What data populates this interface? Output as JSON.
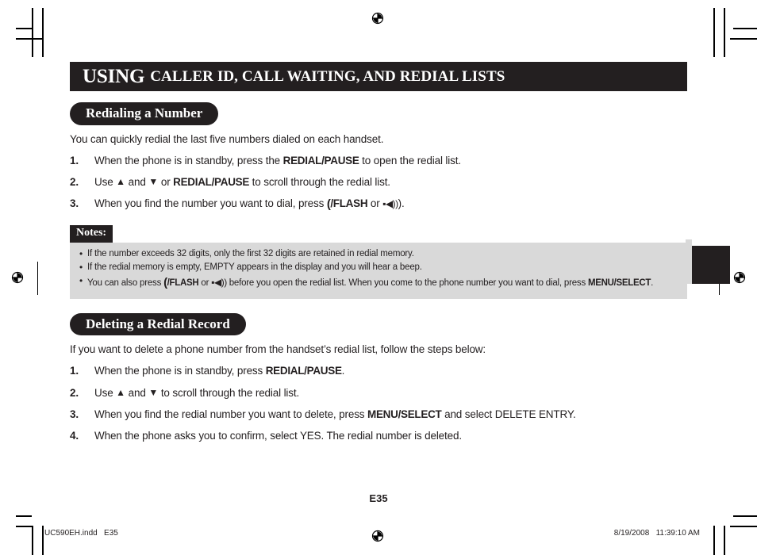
{
  "document": {
    "page_number": "E35",
    "footer_left": "UC590EH.indd   E35",
    "footer_right": "8/19/2008   11:39:10 AM",
    "colors": {
      "ink": "#231f20",
      "notes_background": "#d9d9d9",
      "paper": "#ffffff"
    }
  },
  "header": {
    "title_main": "USING",
    "title_rest": "CALLER ID, CALL WAITING, AND REDIAL LISTS"
  },
  "sections": [
    {
      "heading": "Redialing a Number",
      "intro": "You can quickly redial the last five numbers dialed on each handset.",
      "steps": [
        {
          "num": "1.",
          "parts": [
            {
              "t": "text",
              "v": "When the phone is in standby, press the "
            },
            {
              "t": "bold",
              "v": "REDIAL/PAUSE"
            },
            {
              "t": "text",
              "v": " to open the redial list."
            }
          ]
        },
        {
          "num": "2.",
          "parts": [
            {
              "t": "text",
              "v": "Use "
            },
            {
              "t": "icon",
              "v": "▲",
              "name": "arrow-up-icon"
            },
            {
              "t": "text",
              "v": " and "
            },
            {
              "t": "icon",
              "v": "▼",
              "name": "arrow-down-icon"
            },
            {
              "t": "text",
              "v": " or "
            },
            {
              "t": "bold",
              "v": "REDIAL/PAUSE"
            },
            {
              "t": "text",
              "v": " to scroll through the redial list."
            }
          ]
        },
        {
          "num": "3.",
          "parts": [
            {
              "t": "text",
              "v": "When you find the number you want to dial, press "
            },
            {
              "t": "talk",
              "v": "(",
              "name": "talk-handset-icon"
            },
            {
              "t": "bold",
              "v": "/FLASH"
            },
            {
              "t": "text",
              "v": " or "
            },
            {
              "t": "spk",
              "v": "▪◀))",
              "name": "speakerphone-icon"
            },
            {
              "t": "text",
              "v": ")."
            }
          ]
        }
      ]
    },
    {
      "heading": "Deleting a Redial Record",
      "intro": "If you want to delete a phone number from the handset’s redial list, follow the steps below:",
      "steps": [
        {
          "num": "1.",
          "parts": [
            {
              "t": "text",
              "v": "When the phone is in standby, press "
            },
            {
              "t": "bold",
              "v": "REDIAL/PAUSE"
            },
            {
              "t": "text",
              "v": "."
            }
          ]
        },
        {
          "num": "2.",
          "parts": [
            {
              "t": "text",
              "v": "Use "
            },
            {
              "t": "icon",
              "v": "▲",
              "name": "arrow-up-icon"
            },
            {
              "t": "text",
              "v": " and "
            },
            {
              "t": "icon",
              "v": "▼",
              "name": "arrow-down-icon"
            },
            {
              "t": "text",
              "v": " to scroll through the redial list."
            }
          ]
        },
        {
          "num": "3.",
          "parts": [
            {
              "t": "text",
              "v": "When you find the redial number you want to delete, press "
            },
            {
              "t": "bold",
              "v": "MENU/SELECT"
            },
            {
              "t": "text",
              "v": " and select DELETE ENTRY."
            }
          ]
        },
        {
          "num": "4.",
          "parts": [
            {
              "t": "text",
              "v": "When the phone asks you to confirm, select YES. The redial number is deleted."
            }
          ]
        }
      ]
    }
  ],
  "notes": {
    "label": "Notes:",
    "items": [
      {
        "parts": [
          {
            "t": "text",
            "v": "If the number exceeds 32 digits, only the first 32 digits are retained in redial memory."
          }
        ]
      },
      {
        "parts": [
          {
            "t": "text",
            "v": "If the redial memory is empty, EMPTY appears in the display and you will hear a beep."
          }
        ]
      },
      {
        "parts": [
          {
            "t": "text",
            "v": "You can also press "
          },
          {
            "t": "talk",
            "v": "(",
            "name": "talk-handset-icon"
          },
          {
            "t": "bold",
            "v": "/FLASH"
          },
          {
            "t": "text",
            "v": " or "
          },
          {
            "t": "spk",
            "v": "▪◀))",
            "name": "speakerphone-icon"
          },
          {
            "t": "text",
            "v": " before you open the redial list. When you come to the phone number you want to dial, press "
          },
          {
            "t": "bold",
            "v": "MENU/SELECT"
          },
          {
            "t": "text",
            "v": "."
          }
        ]
      }
    ]
  }
}
